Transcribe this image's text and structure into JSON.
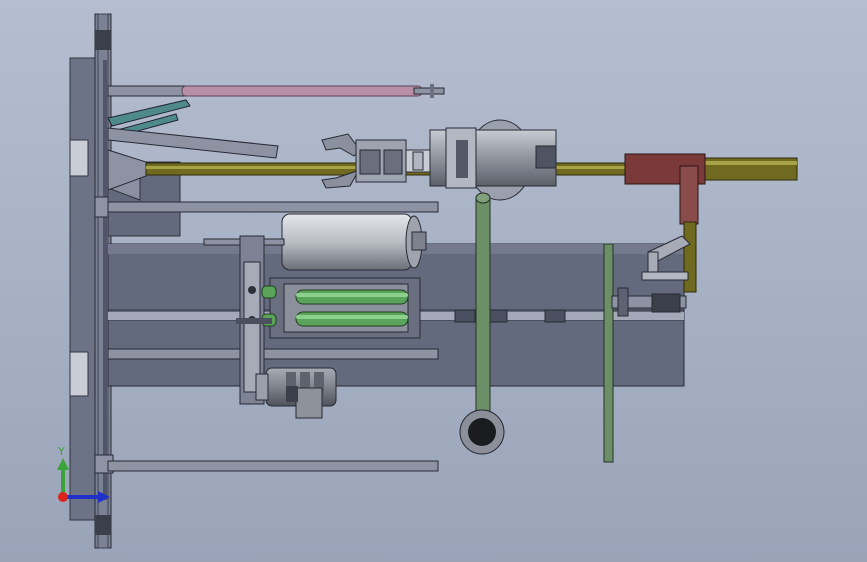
{
  "viewport": {
    "background_top": "#b5bed0",
    "background_bottom": "#9aa4b9"
  },
  "colors": {
    "steel": "#7b8194",
    "steel_dark": "#3f4452",
    "plate": "#5f6578",
    "rod_olive": "#6f6a1f",
    "rod_pink": "#b98fa7",
    "teal": "#4f8a8a",
    "green_strip": "#6c8f67",
    "motor_gray": "#8a8f98",
    "slider_red": "#7a3a3a",
    "roller_green": "#59a35a",
    "axis_x": "#d8261d",
    "axis_y": "#3aa33a",
    "axis_z": "#2130c8"
  },
  "triad": {
    "y_label": "Y",
    "x_icon": "triad-x-arrow",
    "y_icon": "triad-y-arrow"
  }
}
